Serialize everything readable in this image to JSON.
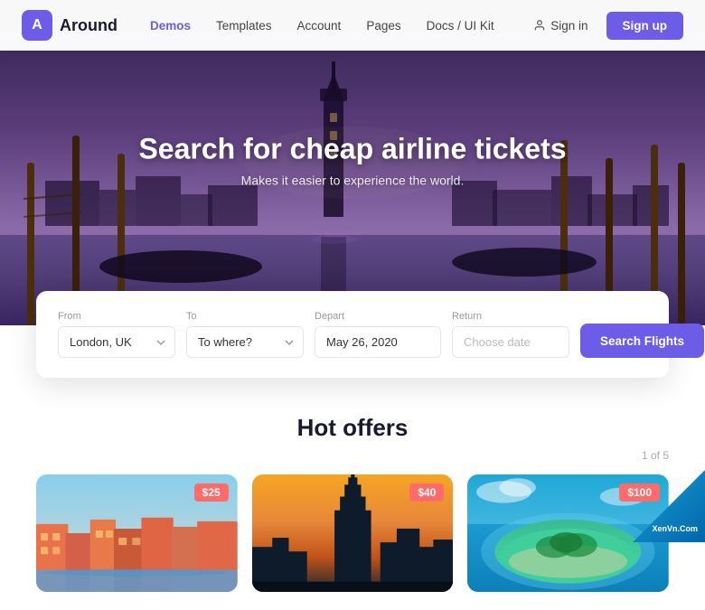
{
  "brand": {
    "icon_letter": "A",
    "name": "Around"
  },
  "navbar": {
    "links": [
      {
        "label": "Demos",
        "active": true
      },
      {
        "label": "Templates",
        "active": false
      },
      {
        "label": "Account",
        "active": false
      },
      {
        "label": "Pages",
        "active": false
      },
      {
        "label": "Docs / UI Kit",
        "active": false
      }
    ],
    "sign_in": "Sign in",
    "sign_up": "Sign up"
  },
  "hero": {
    "title": "Search for cheap airline tickets",
    "subtitle": "Makes it easier to experience the world."
  },
  "search_form": {
    "from_label": "From",
    "from_value": "London, UK",
    "to_label": "To",
    "to_placeholder": "To where?",
    "depart_label": "Depart",
    "depart_value": "May 26, 2020",
    "return_label": "Return",
    "return_placeholder": "Choose date",
    "button_label": "Search Flights"
  },
  "hot_offers": {
    "section_title": "Hot offers",
    "pagination": "1 of 5",
    "cards": [
      {
        "price": "$25",
        "alt": "Venice colorful buildings"
      },
      {
        "price": "$40",
        "alt": "Empire State Building at sunset"
      },
      {
        "price": "$100",
        "alt": "Tropical island aerial view"
      }
    ]
  },
  "watermark": {
    "line1": "XenVn.Com"
  }
}
